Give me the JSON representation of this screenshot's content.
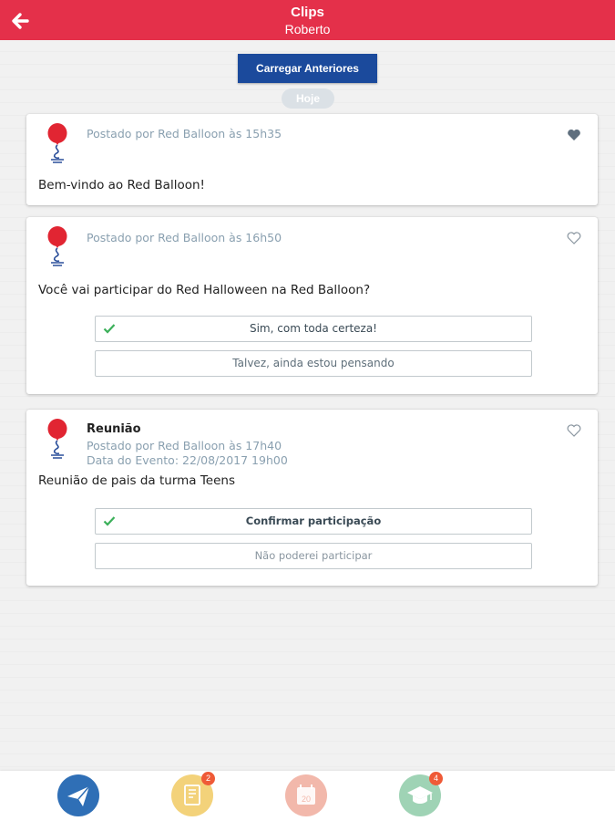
{
  "header": {
    "title": "Clips",
    "subtitle": "Roberto"
  },
  "load_button": "Carregar Anteriores",
  "day_label": "Hoje",
  "posts": [
    {
      "meta": "Postado por Red Balloon às 15h35",
      "message": "Bem-vindo ao Red Balloon!",
      "liked": true
    },
    {
      "meta": "Postado por Red Balloon às 16h50",
      "message": "Você vai participar do Red Halloween na Red Balloon?",
      "options": [
        "Sim, com toda certeza!",
        "Talvez, ainda estou pensando"
      ],
      "selected_option": 0,
      "liked": false
    },
    {
      "title": "Reunião",
      "meta": "Postado por Red Balloon às 17h40",
      "event_date": "Data do Evento: 22/08/2017 19h00",
      "message": "Reunião de pais da turma Teens",
      "options": [
        "Confirmar participação",
        "Não poderei participar"
      ],
      "selected_option": 0,
      "liked": false
    }
  ],
  "bottom_nav": [
    {
      "icon": "send-icon",
      "color": "#2f6fb6"
    },
    {
      "icon": "notebook-icon",
      "color": "#f3d27a",
      "badge": "2"
    },
    {
      "icon": "calendar-icon",
      "color": "#f2b8ab",
      "calendar_day": "20"
    },
    {
      "icon": "graduation-cap-icon",
      "color": "#9fd3b5",
      "badge": "4"
    }
  ],
  "colors": {
    "header": "#e4304a",
    "button": "#1b4a9c",
    "meta": "#8aa0b0",
    "check": "#3cb05a"
  }
}
